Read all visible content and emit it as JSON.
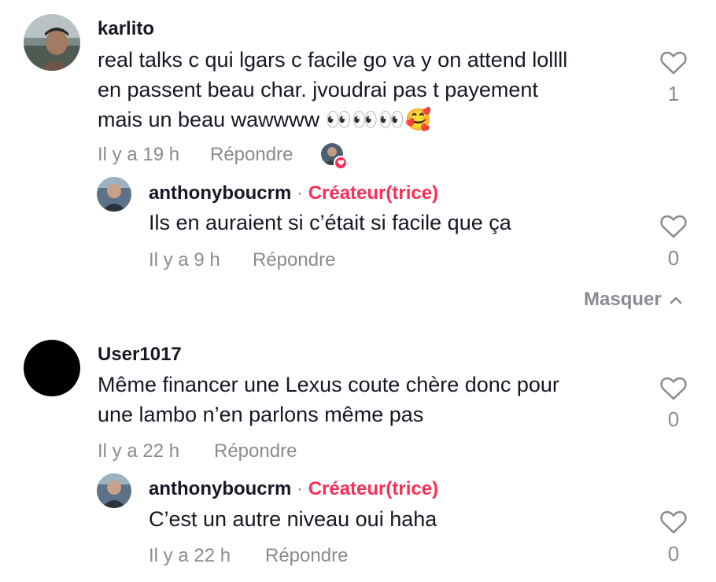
{
  "comments": [
    {
      "username": "karlito",
      "text_line1": "real talks c qui lgars c facile go va y on attend lollll",
      "text_line2": "en passent beau char. jvoudrai pas t payement",
      "text_line3": "mais un beau wawwww 👀👀👀🥰",
      "time": "Il y a 19 h",
      "reply_label": "Répondre",
      "likes": "1",
      "reply": {
        "username": "anthonyboucrm",
        "separator": "·",
        "badge": "Créateur(trice)",
        "text": "Ils en auraient si c’était si facile que ça",
        "time": "Il y a 9 h",
        "reply_label": "Répondre",
        "likes": "0"
      }
    },
    {
      "username": "User1017",
      "text_line1": "Même financer une Lexus coute chère donc pour",
      "text_line2": "une lambo n’en parlons même pas",
      "time": "Il y a 22 h",
      "reply_label": "Répondre",
      "likes": "0",
      "reply": {
        "username": "anthonyboucrm",
        "separator": "·",
        "badge": "Créateur(trice)",
        "text": "C’est un autre niveau oui haha",
        "time": "Il y a 22 h",
        "reply_label": "Répondre",
        "likes": "0"
      }
    }
  ],
  "masquer_label": "Masquer",
  "colors": {
    "creator": "#fe2c55",
    "muted": "#8a8b91",
    "text": "#161823"
  },
  "icons": [
    "heart-outline-icon",
    "chevron-up-icon",
    "creator-liked-heart-icon"
  ]
}
